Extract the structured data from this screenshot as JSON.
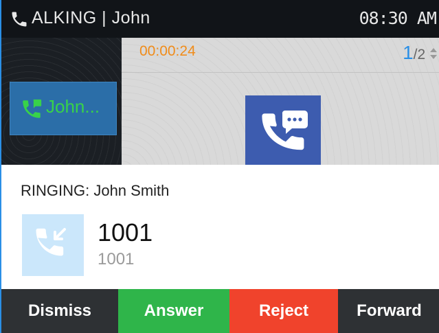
{
  "status_bar": {
    "title": "ALKING | John",
    "clock": "08:30 AM"
  },
  "line_tile": {
    "label": "John..."
  },
  "call": {
    "timer": "00:00:24",
    "page_current": "1",
    "page_total": "/2"
  },
  "incoming": {
    "title": "RINGING: John Smith",
    "number": "1001",
    "sub_number": "1001"
  },
  "softkeys": {
    "dismiss": "Dismiss",
    "answer": "Answer",
    "reject": "Reject",
    "forward": "Forward"
  },
  "colors": {
    "accent_blue": "#2a8fe6",
    "answer_green": "#2fb54a",
    "reject_red": "#f0432c",
    "timer_orange": "#f08c1a",
    "line_green": "#38d24a"
  },
  "icons": {
    "status": "phone-icon",
    "line": "phone-chat-icon",
    "call": "phone-chat-icon",
    "caller": "incoming-call-icon",
    "pager": "up-down-arrows-icon"
  }
}
